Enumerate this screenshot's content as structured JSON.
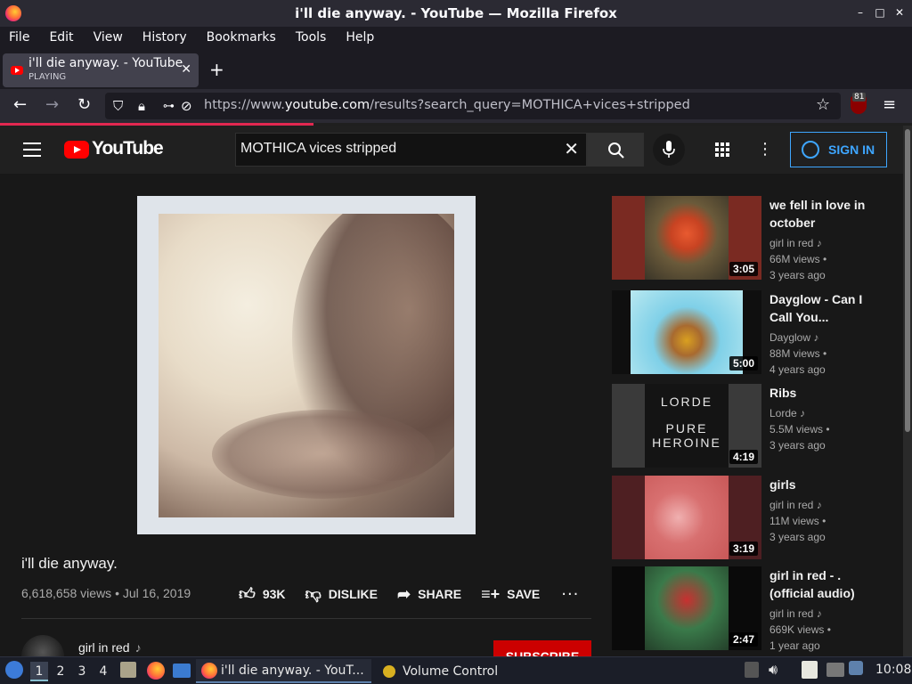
{
  "window": {
    "title": "i'll die anyway. - YouTube — Mozilla Firefox",
    "controls": [
      "–",
      "□",
      "✕"
    ]
  },
  "menubar": [
    "File",
    "Edit",
    "View",
    "History",
    "Bookmarks",
    "Tools",
    "Help"
  ],
  "tab": {
    "title": "i'll die anyway. - YouTube",
    "status": "PLAYING",
    "close": "✕",
    "new_tab": "+"
  },
  "nav": {
    "back": "←",
    "forward": "→",
    "reload": "↻",
    "url_prefix": "https://www.",
    "url_domain": "youtube.com",
    "url_path": "/results?search_query=MOTHICA+vices+stripped",
    "star": "☆",
    "ublock_count": "81",
    "menu": "≡"
  },
  "youtube": {
    "logo_text": "YouTube",
    "search_value": "MOTHICA vices stripped",
    "search_clear": "✕",
    "signin_label": "SIGN IN",
    "more": "⋮"
  },
  "video": {
    "title": "i'll die anyway.",
    "meta": "6,618,658 views • Jul 16, 2019",
    "like_count": "93K",
    "dislike_label": "DISLIKE",
    "share_label": "SHARE",
    "save_label": "SAVE",
    "more": "···",
    "channel": "girl in red",
    "channel_note": "♪",
    "subscribe_label": "SUBSCRIBE"
  },
  "recommendations": [
    {
      "title": "we fell in love in october",
      "channel": "girl in red",
      "views": "66M views •",
      "age": "3 years ago",
      "duration": "3:05"
    },
    {
      "title": "Dayglow - Can I Call You...",
      "channel": "Dayglow",
      "views": "88M views •",
      "age": "4 years ago",
      "duration": "5:00"
    },
    {
      "title": "Ribs",
      "channel": "Lorde",
      "views": "5.5M views •",
      "age": "3 years ago",
      "duration": "4:19",
      "art_line1": "LORDE",
      "art_line2": "PURE",
      "art_line3": "HEROINE"
    },
    {
      "title": "girls",
      "channel": "girl in red",
      "views": "11M views •",
      "age": "3 years ago",
      "duration": "3:19"
    },
    {
      "title": "girl in red - . (official audio)",
      "channel": "girl in red",
      "views": "669K views •",
      "age": "1 year ago",
      "duration": "2:47"
    }
  ],
  "taskbar": {
    "workspaces": [
      "1",
      "2",
      "3",
      "4"
    ],
    "task_firefox": "i'll die anyway. - YouT...",
    "task_volume": "Volume Control",
    "clock": "10:08"
  },
  "colors": {
    "youtube_red": "#ff0000",
    "signin_blue": "#3ea6ff",
    "firefox_loadbar": "#e22850"
  }
}
